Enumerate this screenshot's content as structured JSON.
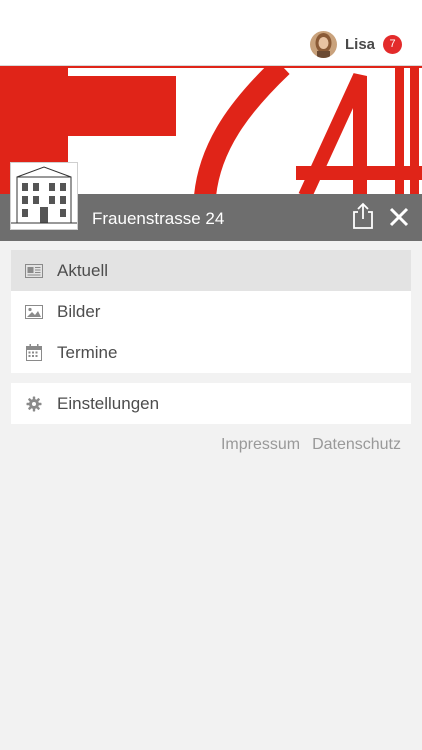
{
  "header": {
    "user_name": "Lisa",
    "notification_count": "7",
    "badge_color": "#e32a2a",
    "avatar_icon": "user-avatar"
  },
  "banner": {
    "logo_text": "F24",
    "accent_color": "#e02418",
    "thumbnail": "building-sketch",
    "title": "Frauenstrasse 24",
    "share_icon": "share-icon",
    "close_icon": "close-icon"
  },
  "menu": {
    "items": [
      {
        "label": "Aktuell",
        "icon": "newspaper-icon",
        "active": true
      },
      {
        "label": "Bilder",
        "icon": "image-icon",
        "active": false
      },
      {
        "label": "Termine",
        "icon": "calendar-icon",
        "active": false
      }
    ],
    "settings": {
      "label": "Einstellungen",
      "icon": "gear-icon"
    }
  },
  "footer": {
    "impressum": "Impressum",
    "datenschutz": "Datenschutz"
  }
}
